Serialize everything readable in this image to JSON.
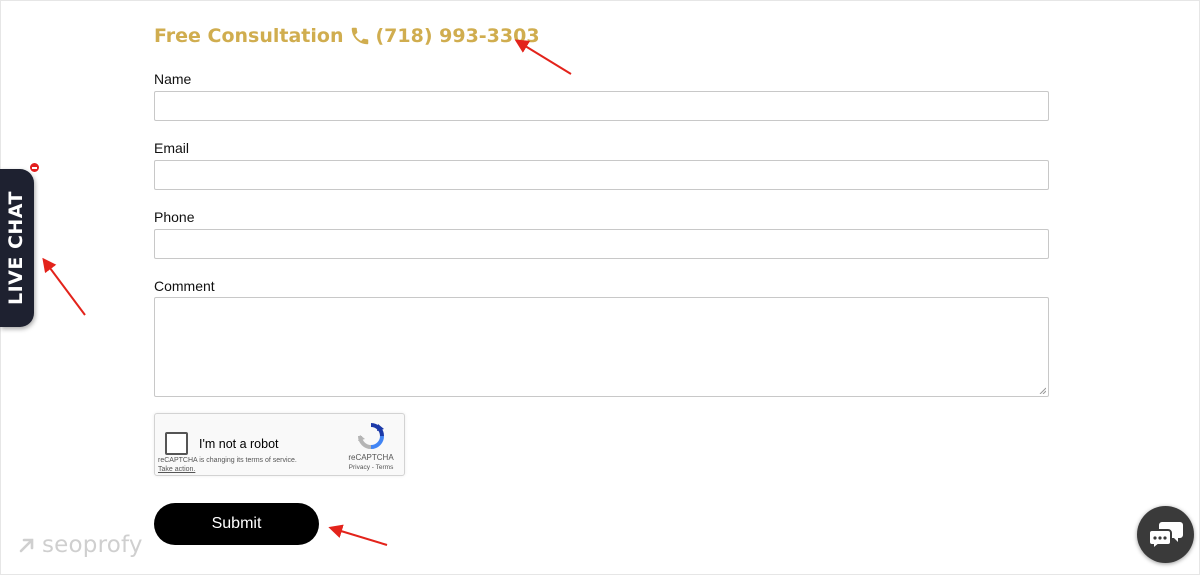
{
  "header": {
    "consult_text": "Free Consultation",
    "phone": "(718) 993-3303",
    "accent_color": "#d0ad4f"
  },
  "form": {
    "name_label": "Name",
    "email_label": "Email",
    "phone_label": "Phone",
    "comment_label": "Comment",
    "name_value": "",
    "email_value": "",
    "phone_value": "",
    "comment_value": "",
    "submit_label": "Submit"
  },
  "recaptcha": {
    "label": "I'm not a robot",
    "notice": "reCAPTCHA is changing its terms of service.",
    "notice_link": "Take action.",
    "brand": "reCAPTCHA",
    "links": "Privacy - Terms",
    "checked": false
  },
  "livechat": {
    "tab_label": "LIVE CHAT",
    "badge_color": "#e21e1e"
  },
  "watermark": {
    "text": "seoprofy"
  },
  "annotation": {
    "arrow_color": "#e3231b"
  },
  "icons": [
    "phone-icon",
    "recaptcha-logo-icon",
    "chat-bubbles-icon",
    "watermark-arrow-icon"
  ]
}
